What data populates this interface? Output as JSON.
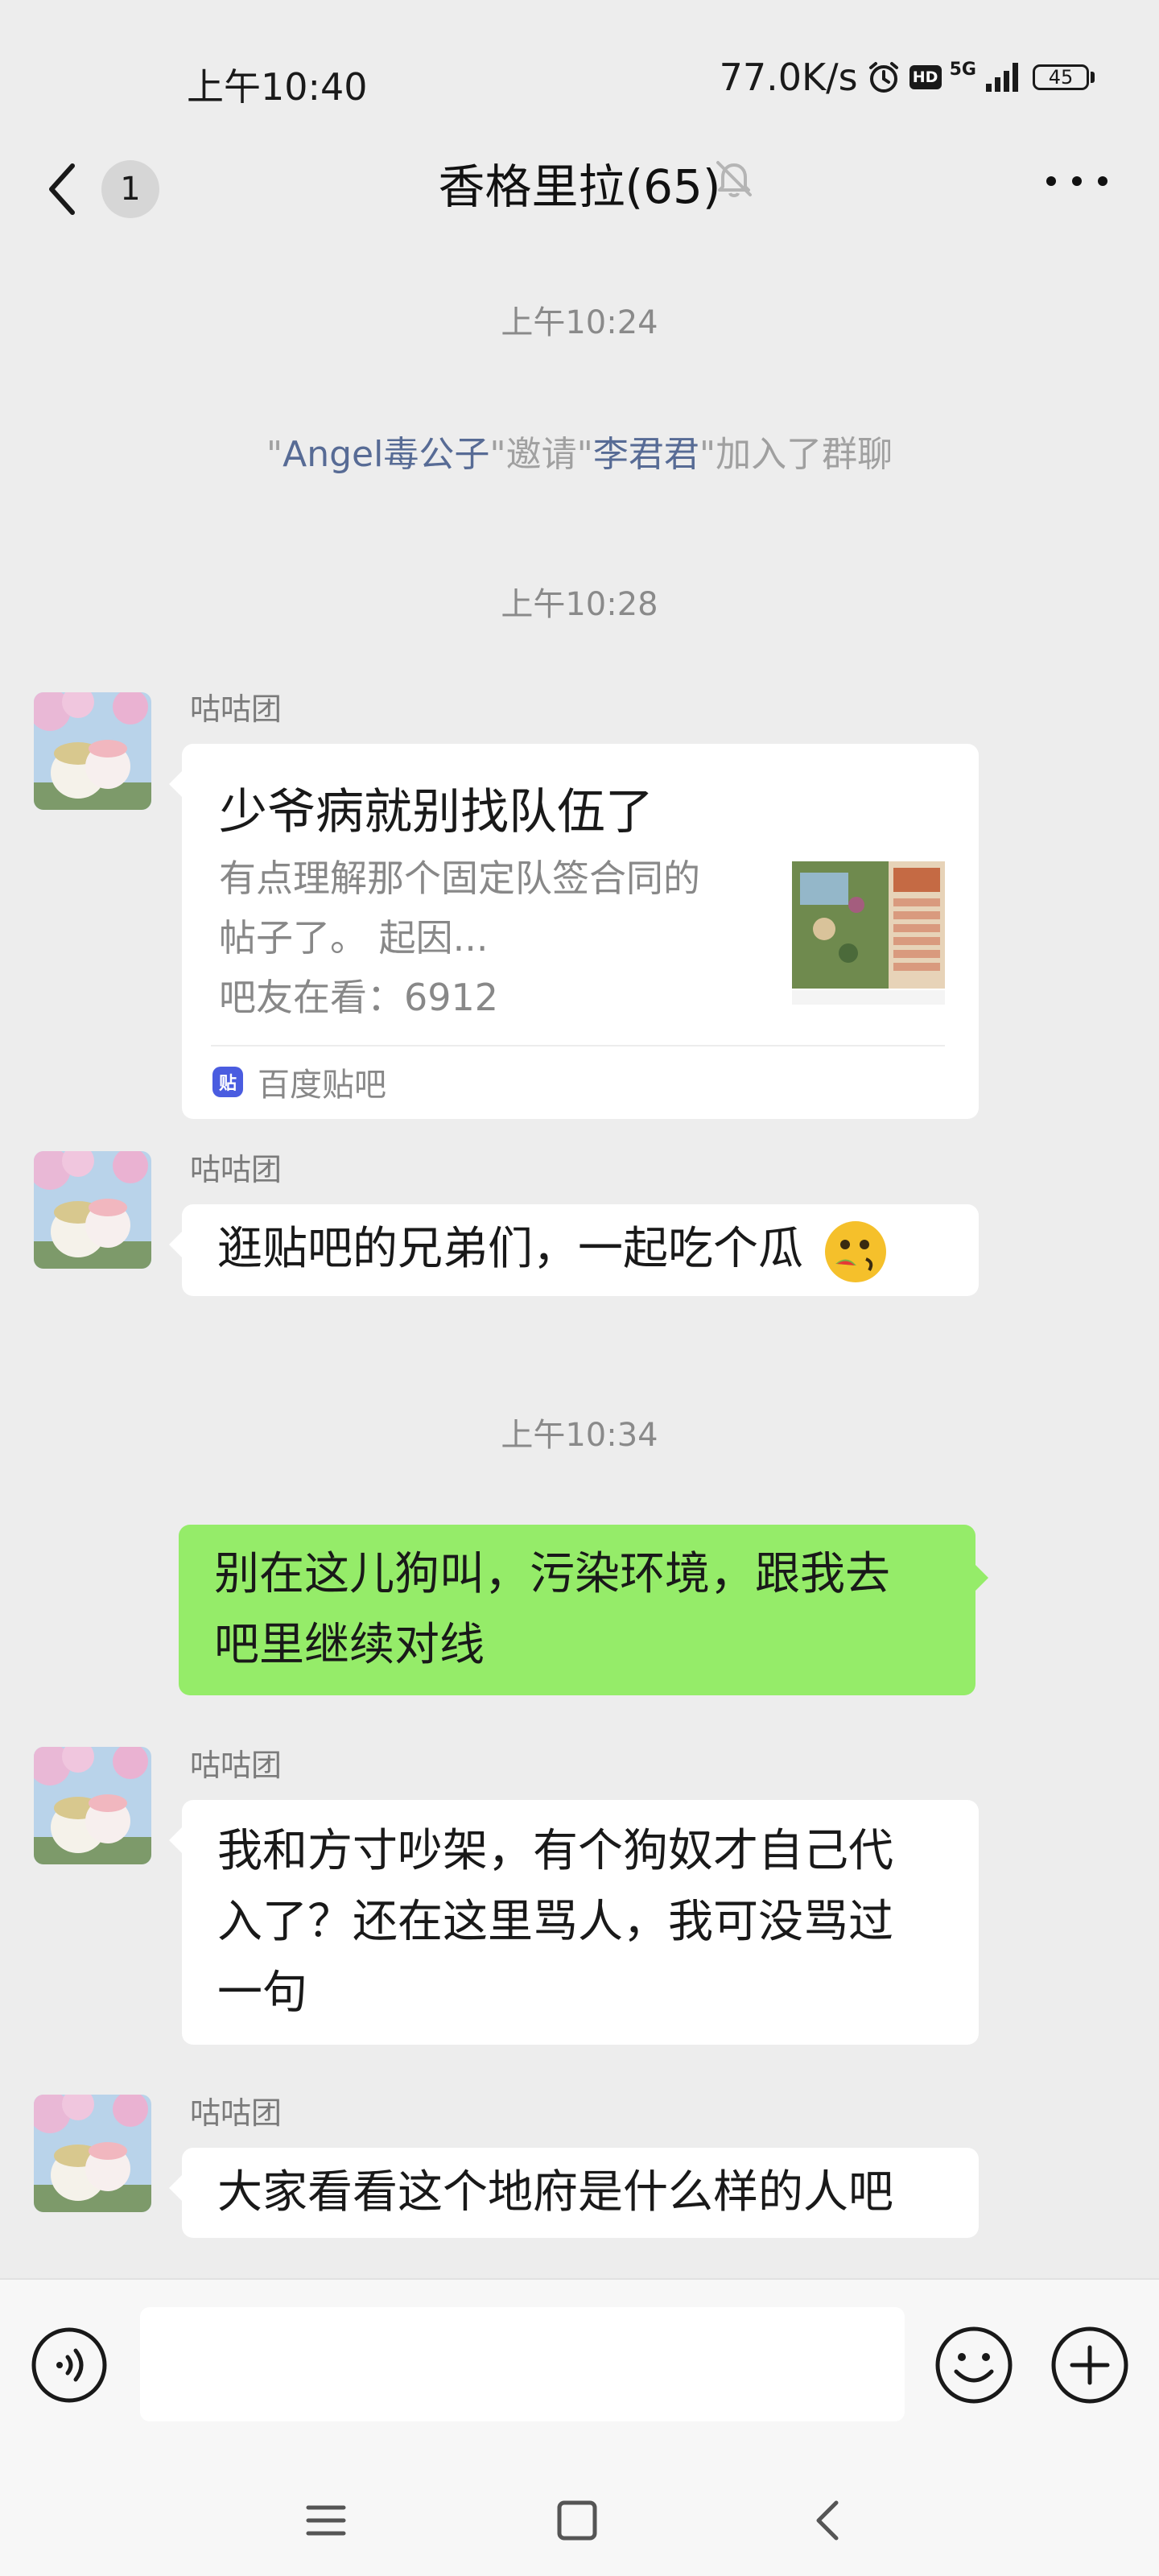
{
  "status_bar": {
    "time": "上午10:40",
    "net_speed": "77.0K/s",
    "hd_label": "HD",
    "network_label": "5G",
    "battery": "45",
    "icons": [
      "alarm-icon",
      "hd-icon",
      "signal-icon",
      "battery-icon"
    ]
  },
  "header": {
    "back_count": "1",
    "title": "香格里拉(65)",
    "icons": [
      "back-arrow-icon",
      "mute-bell-icon",
      "more-icon"
    ]
  },
  "messages": {
    "ts1": "上午10:24",
    "system_invite": {
      "q1": "\"",
      "inviter": "Angel毒公子",
      "q2": "\"邀请\"",
      "invitee": "李君君",
      "q3": "\"加入了群聊"
    },
    "ts2": "上午10:28",
    "msg1": {
      "sender": "咕咕团",
      "card_title": "少爷病就别找队伍了",
      "card_desc_line1": "有点理解那个固定队签合同的",
      "card_desc_line2": "帖子了。 起因...",
      "card_views": "吧友在看：6912",
      "card_source": "百度贴吧",
      "card_logo_text": "贴"
    },
    "msg2": {
      "sender": "咕咕团",
      "text": "逛贴吧的兄弟们，一起吃个瓜"
    },
    "ts3": "上午10:34",
    "msg3": {
      "line1": "别在这儿狗叫，污染环境，跟我去",
      "line2": "吧里继续对线"
    },
    "msg4": {
      "sender": "咕咕团",
      "line1": "我和方寸吵架，有个狗奴才自己代",
      "line2": "入了？还在这里骂人，我可没骂过",
      "line3": "一句"
    },
    "msg5": {
      "sender": "咕咕团",
      "text": "大家看看这个地府是什么样的人吧"
    }
  },
  "input_bar": {
    "value": "",
    "icons": [
      "voice-icon",
      "emoji-icon",
      "plus-icon"
    ]
  },
  "system_nav": {
    "icons": [
      "menu-icon",
      "home-icon",
      "back-icon"
    ]
  },
  "colors": {
    "background": "#ededed",
    "bubble_self": "#95ec69",
    "bubble_other": "#ffffff",
    "link": "#576b95"
  }
}
